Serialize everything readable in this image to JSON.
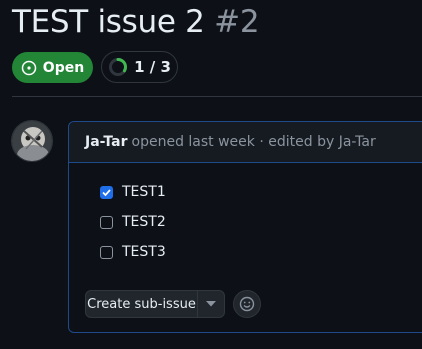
{
  "issue": {
    "title": "TEST issue 2",
    "number": "#2",
    "state_label": "Open",
    "progress_text": "1 / 3",
    "progress_fraction": 0.333
  },
  "comment": {
    "author": "Ja-Tar",
    "meta": "opened last week · edited by Ja-Tar",
    "tasks": [
      {
        "label": "TEST1",
        "checked": true
      },
      {
        "label": "TEST2",
        "checked": false
      },
      {
        "label": "TEST3",
        "checked": false
      }
    ]
  },
  "actions": {
    "create_sub_issue_label": "Create sub-issue"
  },
  "icons": {
    "open": "issue-opened-icon",
    "progress": "progress-ring-icon",
    "avatar": "avatar",
    "checkbox": "checkbox-icon",
    "caret": "chevron-down-icon",
    "emoji": "smiley-icon"
  },
  "colors": {
    "background": "#0d1117",
    "open_green": "#238636",
    "progress_green": "#3fb950",
    "checkbox_blue": "#1f6feb",
    "accent_border": "#1f4a8a"
  }
}
